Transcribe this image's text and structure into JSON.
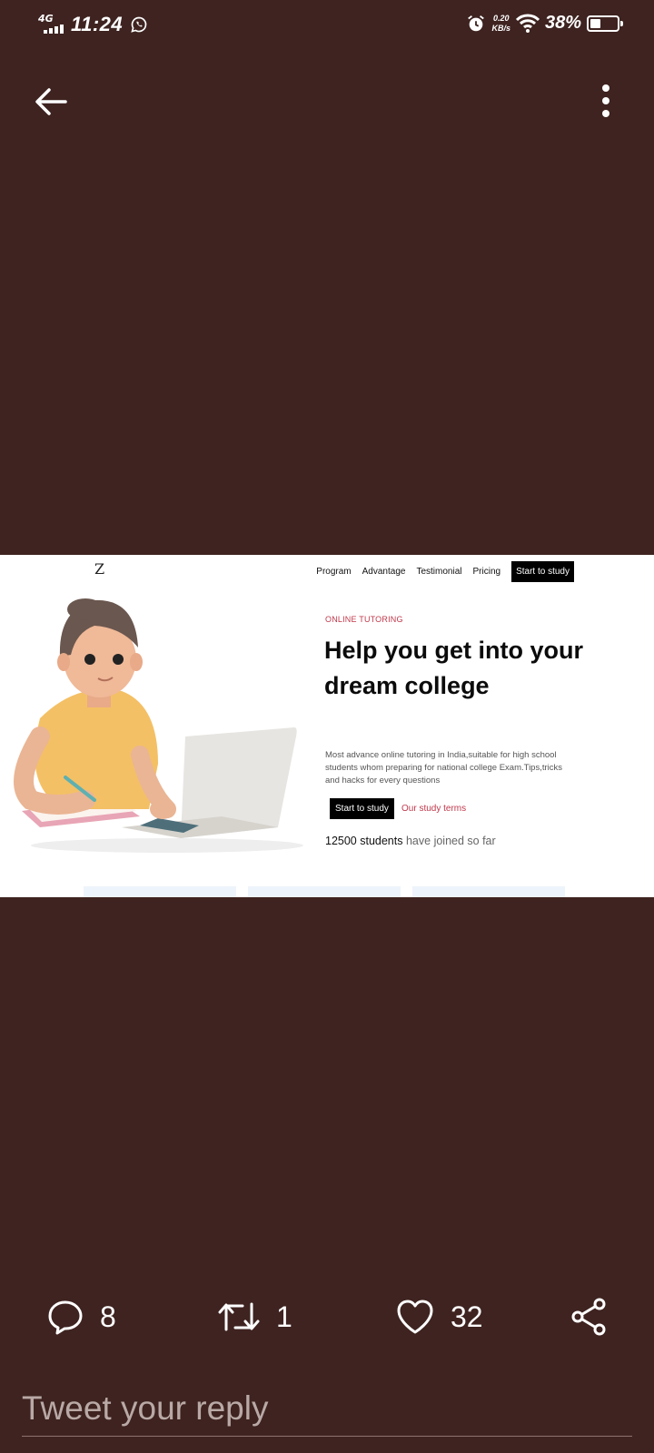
{
  "status_bar": {
    "network": "4G",
    "time": "11:24",
    "speed_value": "0.20",
    "speed_unit": "KB/s",
    "battery_percent": "38%",
    "battery_level": 0.38,
    "icons": [
      "signal-icon",
      "whatsapp-icon",
      "alarm-icon",
      "wifi-icon",
      "battery-icon"
    ]
  },
  "toolbar": {
    "back_icon": "arrow-left-icon",
    "more_icon": "vertical-dots-icon"
  },
  "media": {
    "logo": "Z",
    "nav": [
      "Program",
      "Advantage",
      "Testimonial",
      "Pricing"
    ],
    "nav_cta": "Start to study",
    "tag": "ONLINE TUTORING",
    "headline": "Help you get into your dream college",
    "description": "Most advance online tutoring in India,suitable for high school students whom preparing for national college Exam.Tips,tricks and hacks for every questions",
    "primary_button": "Start to study",
    "secondary_link": "Our study terms",
    "joined_count": "12500 students",
    "joined_text": "have joined so far",
    "accent_color": "#c0384b"
  },
  "actions": {
    "comments": "8",
    "retweets": "1",
    "likes": "32"
  },
  "reply": {
    "placeholder": "Tweet your reply"
  },
  "colors": {
    "background": "#3e2320",
    "foreground": "#ffffff"
  }
}
